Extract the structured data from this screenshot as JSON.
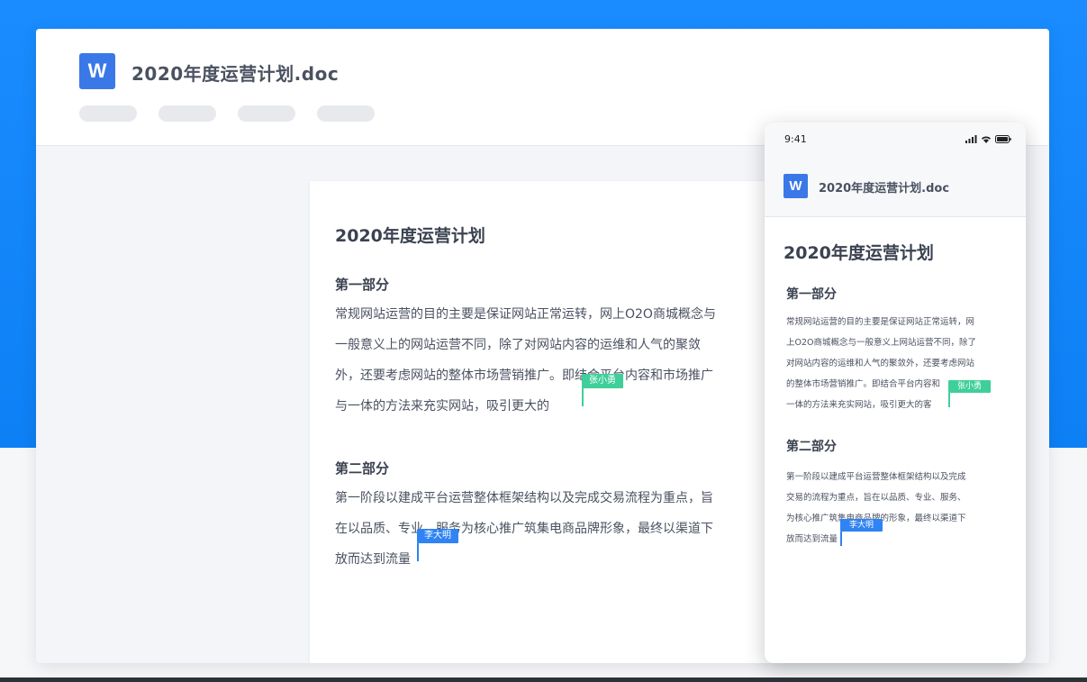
{
  "colors": {
    "brand_blue": "#1a8cff",
    "word_icon": "#3a78e8",
    "cursor_green": "#3ecf9a",
    "cursor_blue": "#2f83f2"
  },
  "desktop": {
    "word_icon_letter": "W",
    "file_name": "2020年度运营计划.doc",
    "tabs": [
      "",
      "",
      "",
      ""
    ],
    "document": {
      "title": "2020年度运营计划",
      "section1": {
        "heading": "第一部分",
        "lines": [
          "常规网站运营的目的主要是保证网站正常运转，网上O2O商城概念与",
          "一般意义上的网站运营不同，除了对网站内容的运维和人气的聚敛",
          "外，还要考虑网站的整体市场营销推广。即结合平台内容和市场推广",
          "与一体的方法来充实网站，吸引更大的"
        ]
      },
      "section2": {
        "heading": "第二部分",
        "lines": [
          "第一阶段以建成平台运营整体框架结构以及完成交易流程为重点，旨",
          "在以品质、专业、服务为核心推广筑集电商品牌形象，最终以渠道下",
          "放而达到流量"
        ]
      }
    },
    "collaborators": [
      {
        "name": "张小勇"
      },
      {
        "name": "李大明"
      }
    ]
  },
  "phone": {
    "status_time": "9:41",
    "icons": [
      "signal-icon",
      "wifi-icon",
      "battery-icon"
    ],
    "word_icon_letter": "W",
    "file_name": "2020年度运营计划.doc",
    "document": {
      "title": "2020年度运营计划",
      "section1": {
        "heading": "第一部分",
        "lines": [
          "常规网站运营的目的主要是保证网站正常运转，网",
          "上O2O商城概念与一般意义上网站运营不同，除了",
          "对网站内容的运维和人气的聚敛外，还要考虑网站",
          "的整体市场营销推广。即结合平台内容和",
          "一体的方法来充实网站，吸引更大的客"
        ]
      },
      "section2": {
        "heading": "第二部分",
        "lines": [
          "第一阶段以建成平台运营整体框架结构以及完成",
          "交易的流程为重点，旨在以品质、专业、服务、",
          "为核心推广筑集电商品牌的形象，最终以渠道下",
          "放而达到流量"
        ]
      }
    },
    "collaborators": [
      {
        "name": "张小勇"
      },
      {
        "name": "李大明"
      }
    ]
  }
}
